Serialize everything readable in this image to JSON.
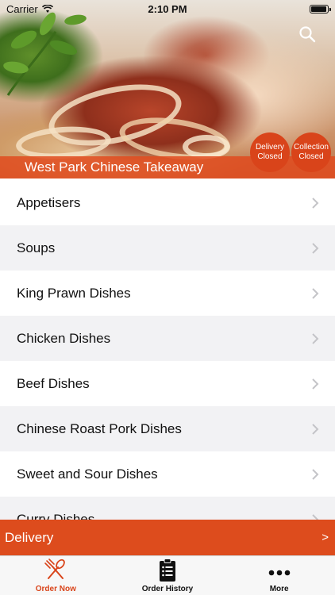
{
  "status_bar": {
    "carrier": "Carrier",
    "time": "2:10 PM"
  },
  "header": {
    "restaurant_name": "West Park Chinese Takeaway",
    "delivery_status": {
      "line1": "Delivery",
      "line2": "Closed"
    },
    "collection_status": {
      "line1": "Collection",
      "line2": "Closed"
    }
  },
  "menu": {
    "items": [
      {
        "label": "Appetisers"
      },
      {
        "label": "Soups"
      },
      {
        "label": "King Prawn Dishes"
      },
      {
        "label": "Chicken Dishes"
      },
      {
        "label": "Beef Dishes"
      },
      {
        "label": "Chinese Roast Pork Dishes"
      },
      {
        "label": "Sweet and Sour Dishes"
      },
      {
        "label": "Curry Dishes"
      }
    ]
  },
  "delivery_bar": {
    "label": "Delivery",
    "arrow": ">"
  },
  "tab_bar": {
    "tabs": [
      {
        "label": "Order Now",
        "icon": "fork-knife-icon",
        "active": true
      },
      {
        "label": "Order History",
        "icon": "clipboard-icon",
        "active": false
      },
      {
        "label": "More",
        "icon": "more-dots-icon",
        "active": false
      }
    ]
  },
  "colors": {
    "accent": "#dd4c1d",
    "row_alt": "#f2f2f4"
  }
}
